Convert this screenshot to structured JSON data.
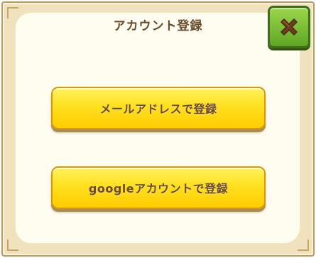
{
  "dialog": {
    "title": "アカウント登録",
    "close_icon": "close-x-icon",
    "buttons": {
      "mail_label": "メールアドレスで登録",
      "google_label": "googleアカウントで登録"
    }
  },
  "colors": {
    "title_text": "#6b4a2b",
    "button_yellow": "#ffe01f",
    "close_green": "#6fb52c",
    "panel_bg": "#fffdef",
    "frame_bg": "#f0e2bd"
  }
}
